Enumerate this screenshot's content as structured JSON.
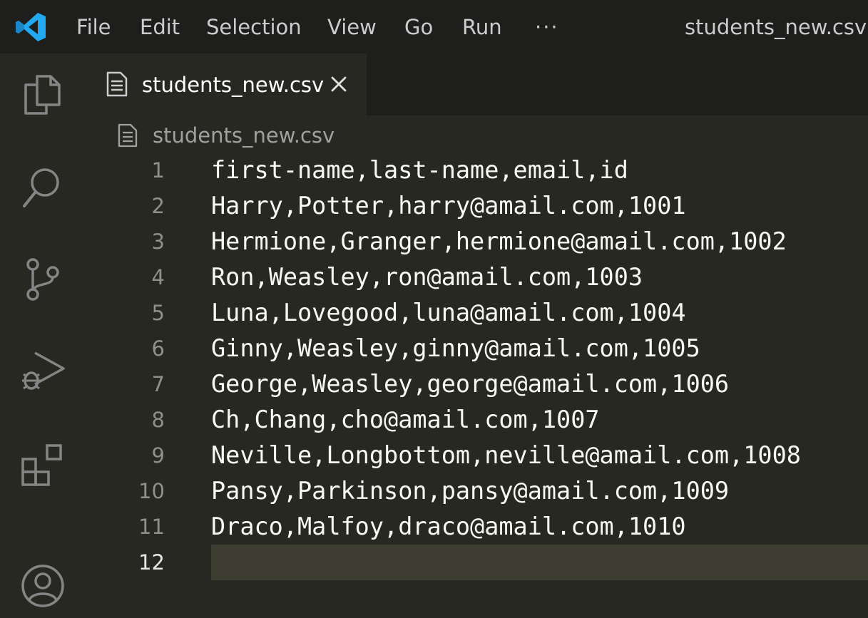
{
  "titlebar": {
    "menu": [
      "File",
      "Edit",
      "Selection",
      "View",
      "Go",
      "Run",
      "···"
    ],
    "window_title": "students_new.csv - "
  },
  "activitybar": {
    "icons": [
      "explorer-icon",
      "search-icon",
      "source-control-icon",
      "run-debug-icon",
      "extensions-icon",
      "account-icon"
    ]
  },
  "tab": {
    "label": "students_new.csv"
  },
  "breadcrumb": {
    "label": "students_new.csv"
  },
  "editor": {
    "current_line": 12,
    "lines": [
      {
        "num": "1",
        "text": "first-name,last-name,email,id"
      },
      {
        "num": "2",
        "text": "Harry,Potter,harry@amail.com,1001"
      },
      {
        "num": "3",
        "text": "Hermione,Granger,hermione@amail.com,1002"
      },
      {
        "num": "4",
        "text": "Ron,Weasley,ron@amail.com,1003"
      },
      {
        "num": "5",
        "text": "Luna,Lovegood,luna@amail.com,1004"
      },
      {
        "num": "6",
        "text": "Ginny,Weasley,ginny@amail.com,1005"
      },
      {
        "num": "7",
        "text": "George,Weasley,george@amail.com,1006"
      },
      {
        "num": "8",
        "text": "Ch,Chang,cho@amail.com,1007"
      },
      {
        "num": "9",
        "text": "Neville,Longbottom,neville@amail.com,1008"
      },
      {
        "num": "10",
        "text": "Pansy,Parkinson,pansy@amail.com,1009"
      },
      {
        "num": "11",
        "text": "Draco,Malfoy,draco@amail.com,1010"
      },
      {
        "num": "12",
        "text": ""
      }
    ]
  },
  "colors": {
    "editor_bg": "#272822",
    "titlebar_bg": "#1e1f1c",
    "current_line_bg": "#3e3d32",
    "logo_blue": "#23a9f2"
  }
}
